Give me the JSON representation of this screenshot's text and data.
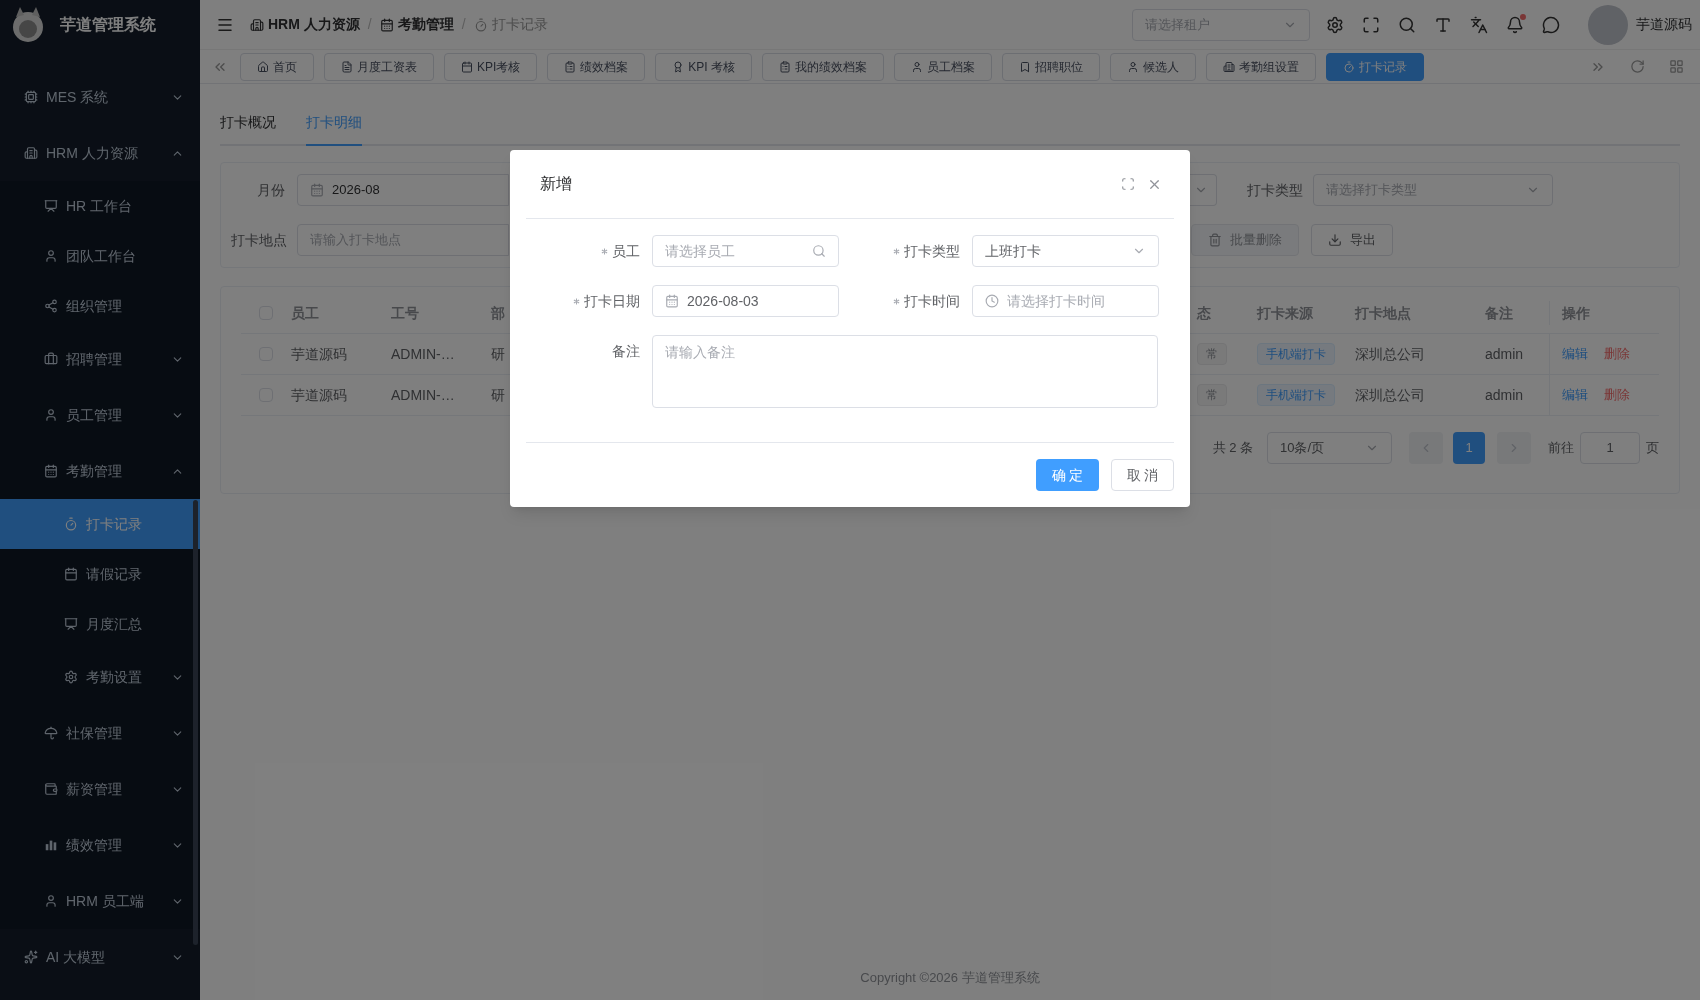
{
  "brand": "芋道管理系统",
  "menu": [
    {
      "label": "MES 系统",
      "kind": "submenu",
      "expanded": false
    },
    {
      "label": "HRM 人力资源",
      "kind": "submenu",
      "expanded": true,
      "children": [
        {
          "label": "HR 工作台",
          "kind": "item",
          "selected": false
        },
        {
          "label": "团队工作台",
          "kind": "item",
          "selected": false
        },
        {
          "label": "组织管理",
          "kind": "item",
          "selected": false
        },
        {
          "label": "招聘管理",
          "kind": "submenu",
          "expanded": false
        },
        {
          "label": "员工管理",
          "kind": "submenu",
          "expanded": false
        },
        {
          "label": "考勤管理",
          "kind": "submenu",
          "expanded": true,
          "children": [
            {
              "label": "打卡记录",
              "kind": "item",
              "selected": true
            },
            {
              "label": "请假记录",
              "kind": "item",
              "selected": false
            },
            {
              "label": "月度汇总",
              "kind": "item",
              "selected": false
            },
            {
              "label": "考勤设置",
              "kind": "submenu",
              "expanded": false
            }
          ]
        },
        {
          "label": "社保管理",
          "kind": "submenu",
          "expanded": false
        },
        {
          "label": "薪资管理",
          "kind": "submenu",
          "expanded": false
        },
        {
          "label": "绩效管理",
          "kind": "submenu",
          "expanded": false
        },
        {
          "label": "HRM 员工端",
          "kind": "submenu",
          "expanded": false
        }
      ]
    },
    {
      "label": "AI 大模型",
      "kind": "submenu",
      "expanded": false
    }
  ],
  "breadcrumb": [
    {
      "label": "HRM 人力资源"
    },
    {
      "separator": "/",
      "label": "考勤管理"
    },
    {
      "separator": "/",
      "label": "打卡记录"
    }
  ],
  "tenant_select": {
    "placeholder": "请选择租户"
  },
  "notification_dot": true,
  "user_name": "芋道源码",
  "page_tabs": [
    {
      "label": "首页",
      "selected": false
    },
    {
      "label": "月度工资表",
      "selected": false
    },
    {
      "label": "KPI考核",
      "selected": false
    },
    {
      "label": "绩效档案",
      "selected": false
    },
    {
      "label": "KPI 考核",
      "selected": false
    },
    {
      "label": "我的绩效档案",
      "selected": false
    },
    {
      "label": "员工档案",
      "selected": false
    },
    {
      "label": "招聘职位",
      "selected": false
    },
    {
      "label": "候选人",
      "selected": false
    },
    {
      "label": "考勤组设置",
      "selected": false
    },
    {
      "label": "打卡记录",
      "selected": true
    }
  ],
  "view_tabs": [
    {
      "label": "打卡概况",
      "selected": false
    },
    {
      "label": "打卡明细",
      "selected": true
    }
  ],
  "filters": [
    {
      "label": "月份",
      "kind": "month",
      "value": "2026-08"
    },
    {
      "kind": "select-edge"
    },
    {
      "label": "打卡类型",
      "kind": "select",
      "placeholder": "请选择打卡类型"
    },
    {
      "label": "打卡地点",
      "kind": "input",
      "placeholder": "请输入打卡地点"
    }
  ],
  "actions": [
    {
      "label": "批量删除",
      "kind": "delete",
      "disabled": true
    },
    {
      "label": "导出",
      "kind": "export",
      "disabled": false
    }
  ],
  "table": {
    "all_checked": false,
    "columns": [
      "员工",
      "工号",
      "部",
      "态",
      "打卡来源",
      "打卡地点",
      "备注",
      "操作"
    ],
    "rows": [
      {
        "checked": false,
        "cells": [
          "芋道源码",
          "ADMIN-…",
          "研",
          "常",
          "手机端打卡",
          "深圳总公司",
          "admin"
        ],
        "actions": [
          "编辑",
          "删除"
        ]
      },
      {
        "checked": false,
        "cells": [
          "芋道源码",
          "ADMIN-…",
          "研",
          "常",
          "手机端打卡",
          "深圳总公司",
          "admin"
        ],
        "actions": [
          "编辑",
          "删除"
        ]
      }
    ]
  },
  "pagination": {
    "total": "共 2 条",
    "page_size": "10条/页",
    "pages": [
      {
        "label": "1",
        "selected": true
      }
    ],
    "goto_label": "前往",
    "goto_value": "1",
    "page_suffix": "页"
  },
  "footer": "Copyright ©2026 芋道管理系统",
  "dialog": {
    "title": "新增",
    "fields": [
      {
        "label": "员工",
        "required": true,
        "kind": "search",
        "placeholder": "请选择员工"
      },
      {
        "label": "打卡类型",
        "required": true,
        "kind": "select",
        "value": "上班打卡"
      },
      {
        "label": "打卡日期",
        "required": true,
        "kind": "date",
        "value": "2026-08-03"
      },
      {
        "label": "打卡时间",
        "required": true,
        "kind": "time",
        "placeholder": "请选择打卡时间"
      },
      {
        "label": "备注",
        "required": false,
        "kind": "textarea",
        "placeholder": "请输入备注"
      }
    ],
    "buttons": [
      {
        "label": "确 定",
        "kind": "primary"
      },
      {
        "label": "取 消",
        "kind": "default"
      }
    ]
  }
}
